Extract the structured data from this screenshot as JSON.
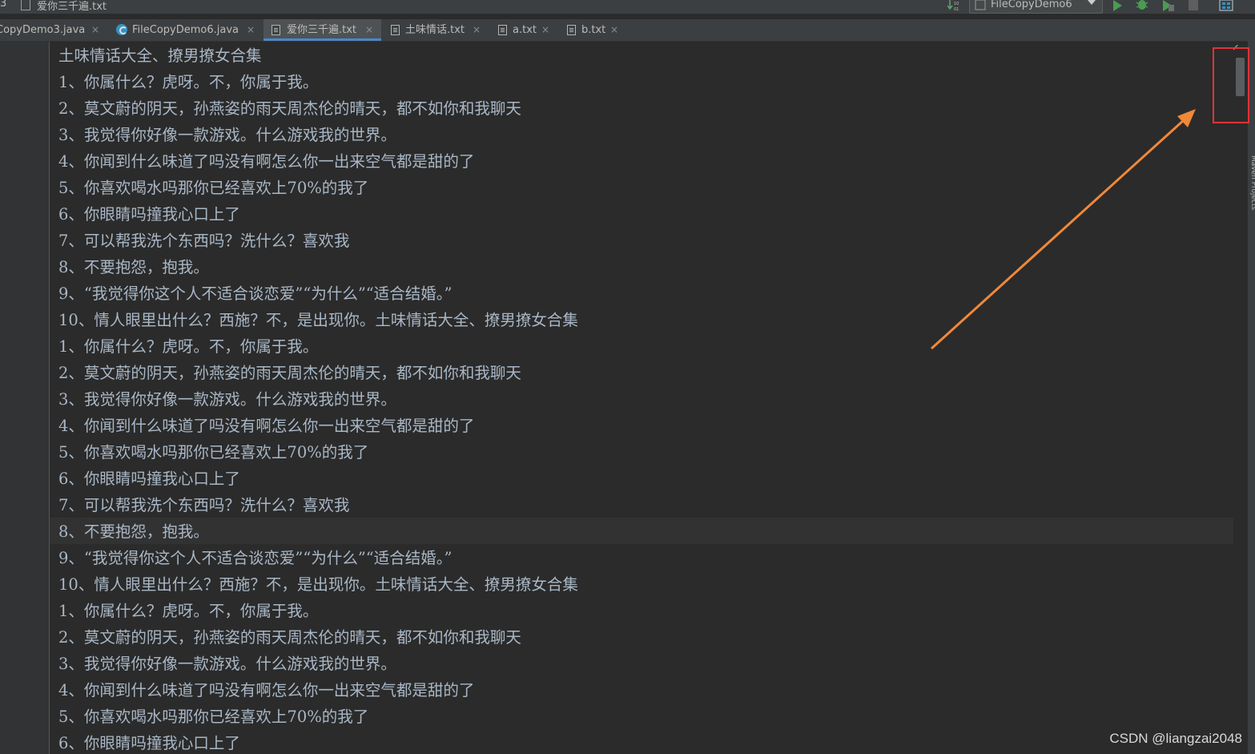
{
  "toolbar": {
    "breadcrumb_num": "3",
    "breadcrumb_file": "爱你三千遍.txt",
    "run_config": "FileCopyDemo6"
  },
  "tabs": [
    {
      "label": "CopyDemo3.java",
      "close": "×",
      "icon": "java-class-icon",
      "active": false
    },
    {
      "label": "FileCopyDemo6.java",
      "close": "×",
      "icon": "java-class-icon",
      "active": false
    },
    {
      "label": "爱你三千遍.txt",
      "close": "×",
      "icon": "text-file-icon",
      "active": true
    },
    {
      "label": "土味情话.txt",
      "close": "×",
      "icon": "text-file-icon",
      "active": false
    },
    {
      "label": "a.txt",
      "close": "×",
      "icon": "text-file-icon",
      "active": false
    },
    {
      "label": "b.txt",
      "close": "×",
      "icon": "text-file-icon",
      "active": false
    }
  ],
  "editor": {
    "lines": [
      "土味情话大全、撩男撩女合集",
      "1、你属什么？虎呀。不，你属于我。",
      "2、莫文蔚的阴天，孙燕姿的雨天周杰伦的晴天，都不如你和我聊天",
      "3、我觉得你好像一款游戏。什么游戏我的世界。",
      "4、你闻到什么味道了吗没有啊怎么你一出来空气都是甜的了",
      "5、你喜欢喝水吗那你已经喜欢上70%的我了",
      "6、你眼睛吗撞我心口上了",
      "7、可以帮我洗个东西吗？洗什么？喜欢我",
      "8、不要抱怨，抱我。",
      "9、“我觉得你这个人不适合谈恋爱”“为什么”“适合结婚。”",
      "10、情人眼里出什么？西施？不，是出现你。土味情话大全、撩男撩女合集",
      "1、你属什么？虎呀。不，你属于我。",
      "2、莫文蔚的阴天，孙燕姿的雨天周杰伦的晴天，都不如你和我聊天",
      "3、我觉得你好像一款游戏。什么游戏我的世界。",
      "4、你闻到什么味道了吗没有啊怎么你一出来空气都是甜的了",
      "5、你喜欢喝水吗那你已经喜欢上70%的我了",
      "6、你眼睛吗撞我心口上了",
      "7、可以帮我洗个东西吗？洗什么？喜欢我",
      "8、不要抱怨，抱我。",
      "9、“我觉得你这个人不适合谈恋爱”“为什么”“适合结婚。”",
      "10、情人眼里出什么？西施？不，是出现你。土味情话大全、撩男撩女合集",
      "1、你属什么？虎呀。不，你属于我。",
      "2、莫文蔚的阴天，孙燕姿的雨天周杰伦的晴天，都不如你和我聊天",
      "3、我觉得你好像一款游戏。什么游戏我的世界。",
      "4、你闻到什么味道了吗没有啊怎么你一出来空气都是甜的了",
      "5、你喜欢喝水吗那你已经喜欢上70%的我了",
      "6、你眼睛吗撞我心口上了"
    ],
    "caret_line_index": 18
  },
  "side_panel": {
    "label": "Maven Projects"
  },
  "annotation": {
    "arrow_color": "#f0883a",
    "box_color": "#e0323a"
  },
  "watermark": "CSDN @liangzai2048",
  "colors": {
    "editor_bg": "#2b2b2b",
    "text": "#a9b7c6",
    "tab_active_bg": "#4e5254",
    "tab_underline": "#4a88c7"
  }
}
